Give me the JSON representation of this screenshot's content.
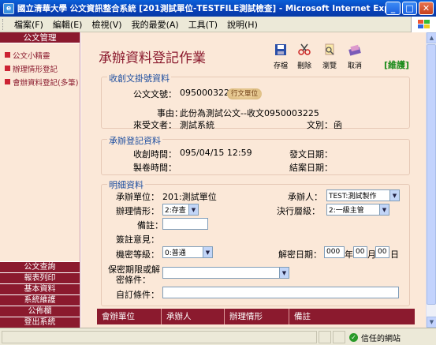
{
  "window": {
    "title": "國立清華大學 公文資訊整合系統 [201測試單位-TESTFILE測試檢查] - Microsoft Internet Explorer",
    "app_icon_glyph": "e"
  },
  "menu": [
    "檔案(F)",
    "編輯(E)",
    "檢視(V)",
    "我的最愛(A)",
    "工具(T)",
    "說明(H)"
  ],
  "sidebar": {
    "header": "公文管理",
    "links": [
      "公文小精靈",
      "辦理情形登記",
      "會辦資料登記(多筆)"
    ],
    "bottom_buttons": [
      "公文查詢",
      "報表列印",
      "基本資料",
      "系統維護",
      "公佈欄",
      "登出系統"
    ]
  },
  "page": {
    "title": "承辦資料登記作業",
    "toolbar": [
      {
        "label": "存檔",
        "icon": "save-icon"
      },
      {
        "label": "刪除",
        "icon": "scissors-icon"
      },
      {
        "label": "瀏覽",
        "icon": "browse-icon"
      },
      {
        "label": "取消",
        "icon": "cancel-icon"
      }
    ],
    "maintain_label": "[維護]"
  },
  "receive_section": {
    "title": "收創文掛號資料",
    "doc_no_label": "公文文號：",
    "doc_no": "0950003225",
    "stamp": "行文單位",
    "subject_label": "事由：",
    "subject": "此份為測試公文--收文0950003225",
    "recipient_label": "來受文者：",
    "recipient": "測試系統",
    "doc_type_label": "文別：",
    "doc_type": "函"
  },
  "handling_section": {
    "title": "承辦登記資料",
    "received_time_label": "收創時間：",
    "received_time": "095/04/15 12:59",
    "send_date_label": "發文日期：",
    "send_date": "",
    "draft_time_label": "製卷時間：",
    "draft_time": "",
    "close_date_label": "結案日期：",
    "close_date": ""
  },
  "detail_section": {
    "title": "明細資料",
    "unit_label": "承辦單位：",
    "unit": "201:測試單位",
    "handler_label": "承辦人：",
    "handler": "TEST:測試製作",
    "status_label": "辦理情形：",
    "status": "2:存查",
    "decision_label": "決行層級：",
    "decision": "2:一級主管",
    "remark_label": "備註：",
    "remark": "",
    "comment_label": "簽註意見：",
    "secret_label": "機密等級：",
    "secret": "0:普通",
    "declassify_label": "解密日期：",
    "declassify_year": "000",
    "declassify_month": "00",
    "declassify_day": "00",
    "year_unit": "年",
    "month_unit": "月",
    "day_unit": "日",
    "secret_cond_label_1": "保密期限或解",
    "secret_cond_label_2": "密條件：",
    "secret_cond": "",
    "custom_cond_label": "自訂條件：",
    "custom_cond": ""
  },
  "table": {
    "headers": [
      "會辦單位",
      "承辦人",
      "辦理情形",
      "備註"
    ]
  },
  "status_bar": {
    "zone": "信任的網站"
  }
}
